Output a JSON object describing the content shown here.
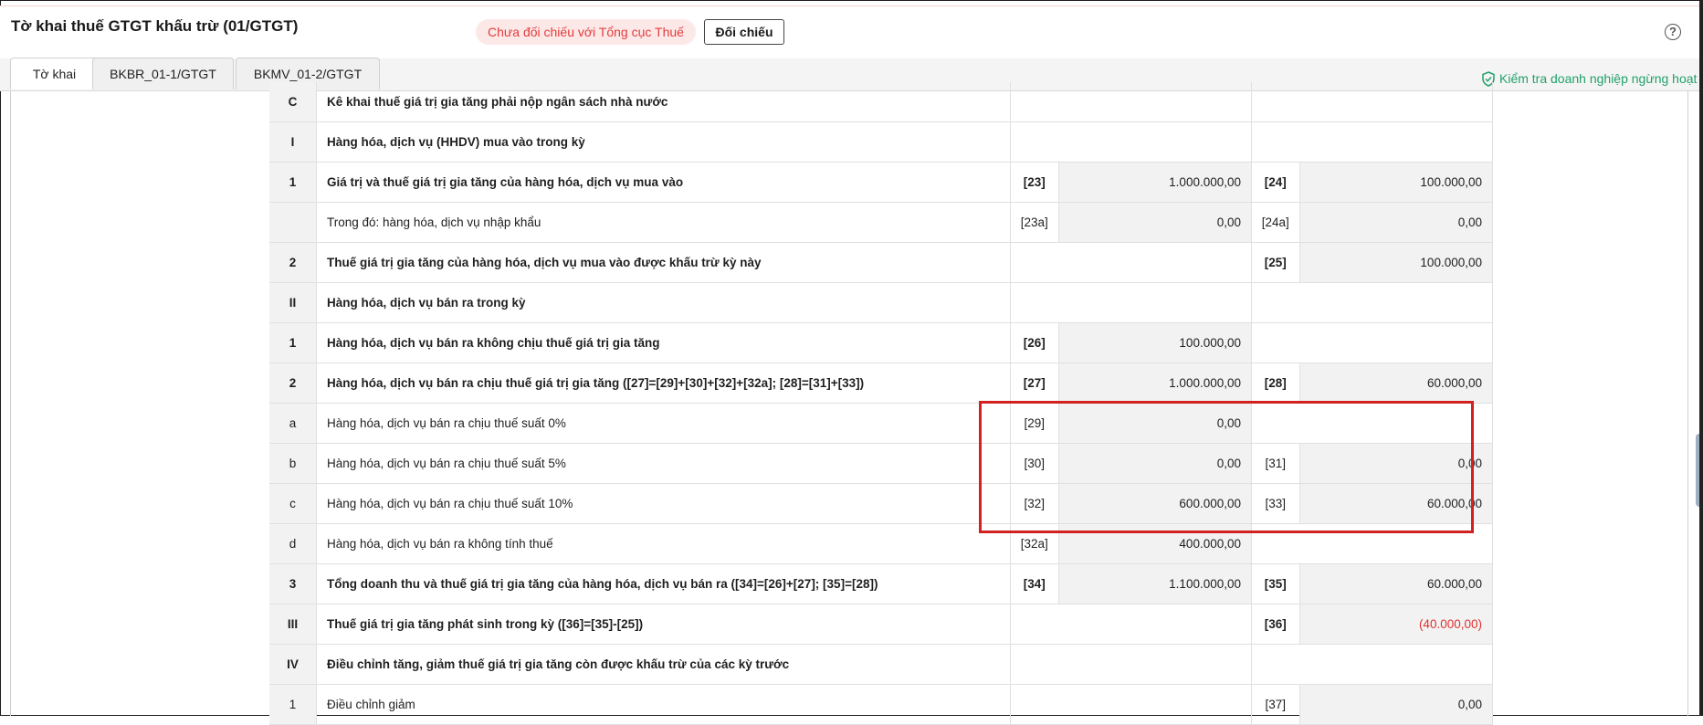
{
  "header": {
    "title": "Tờ khai thuế GTGT khấu trừ (01/GTGT)",
    "status_badge": "Chưa đối chiếu với Tổng cục Thuế",
    "compare_button": "Đối chiếu",
    "help_icon": "help-circle-icon"
  },
  "tabs": [
    {
      "label": "Tờ khai",
      "active": true
    },
    {
      "label": "BKBR_01-1/GTGT",
      "active": false
    },
    {
      "label": "BKMV_01-2/GTGT",
      "active": false
    }
  ],
  "check_link": {
    "icon": "shield-check-icon",
    "label": "Kiểm tra doanh nghiệp ngừng hoạt động"
  },
  "colors": {
    "accent_green": "#22a06b",
    "badge_red": "#e33b3b",
    "negative_red": "#e03030",
    "highlight_red": "#d32020"
  },
  "table": {
    "rows": [
      {
        "no": "C",
        "desc": "Kê khai thuế giá trị gia tăng phải nộp ngân sách nhà nước",
        "bold": true,
        "code1": "",
        "val1": "",
        "code2": "",
        "val2": ""
      },
      {
        "no": "I",
        "desc": "Hàng hóa, dịch vụ (HHDV) mua vào trong kỳ",
        "bold": true,
        "code1": "",
        "val1": "",
        "code2": "",
        "val2": ""
      },
      {
        "no": "1",
        "desc": "Giá trị và thuế giá trị gia tăng của hàng hóa, dịch vụ mua vào",
        "bold": true,
        "code1": "[23]",
        "val1": "1.000.000,00",
        "code2": "[24]",
        "val2": "100.000,00"
      },
      {
        "no": "",
        "desc": "Trong đó: hàng hóa, dịch vụ nhập khẩu",
        "bold": false,
        "code1": "[23a]",
        "val1": "0,00",
        "code2": "[24a]",
        "val2": "0,00"
      },
      {
        "no": "2",
        "desc": "Thuế giá trị gia tăng của hàng hóa, dịch vụ mua vào được khấu trừ kỳ này",
        "bold": true,
        "code1": "",
        "val1": "",
        "code2": "[25]",
        "val2": "100.000,00"
      },
      {
        "no": "II",
        "desc": "Hàng hóa, dịch vụ bán ra trong kỳ",
        "bold": true,
        "code1": "",
        "val1": "",
        "code2": "",
        "val2": ""
      },
      {
        "no": "1",
        "desc": "Hàng hóa, dịch vụ bán ra không chịu thuế giá trị gia tăng",
        "bold": true,
        "code1": "[26]",
        "val1": "100.000,00",
        "code2": "",
        "val2": ""
      },
      {
        "no": "2",
        "desc": "Hàng hóa, dịch vụ bán ra chịu thuế giá trị gia tăng ([27]=[29]+[30]+[32]+[32a]; [28]=[31]+[33])",
        "bold": true,
        "code1": "[27]",
        "val1": "1.000.000,00",
        "code2": "[28]",
        "val2": "60.000,00"
      },
      {
        "no": "a",
        "desc": "Hàng hóa, dịch vụ bán ra chịu thuế suất 0%",
        "bold": false,
        "code1": "[29]",
        "val1": "0,00",
        "code2": "",
        "val2": ""
      },
      {
        "no": "b",
        "desc": "Hàng hóa, dịch vụ bán ra chịu thuế suất 5%",
        "bold": false,
        "code1": "[30]",
        "val1": "0,00",
        "code2": "[31]",
        "val2": "0,00"
      },
      {
        "no": "c",
        "desc": "Hàng hóa, dịch vụ bán ra chịu thuế suất 10%",
        "bold": false,
        "code1": "[32]",
        "val1": "600.000,00",
        "code2": "[33]",
        "val2": "60.000,00"
      },
      {
        "no": "d",
        "desc": "Hàng hóa, dịch vụ bán ra không tính thuế",
        "bold": false,
        "code1": "[32a]",
        "val1": "400.000,00",
        "code2": "",
        "val2": ""
      },
      {
        "no": "3",
        "desc": "Tổng doanh thu và thuế giá trị gia tăng của hàng hóa, dịch vụ bán ra ([34]=[26]+[27]; [35]=[28])",
        "bold": true,
        "code1": "[34]",
        "val1": "1.100.000,00",
        "code2": "[35]",
        "val2": "60.000,00"
      },
      {
        "no": "III",
        "desc": "Thuế giá trị gia tăng phát sinh trong kỳ ([36]=[35]-[25])",
        "bold": true,
        "code1": "",
        "val1": "",
        "code2": "[36]",
        "val2": "(40.000,00)",
        "val2_negative": true
      },
      {
        "no": "IV",
        "desc": "Điều chỉnh tăng, giảm thuế giá trị gia tăng còn được khấu trừ của các kỳ trước",
        "bold": true,
        "code1": "",
        "val1": "",
        "code2": "",
        "val2": ""
      },
      {
        "no": "1",
        "desc": "Điều chỉnh giảm",
        "bold": false,
        "code1": "",
        "val1": "",
        "code2": "[37]",
        "val2": "0,00"
      }
    ]
  }
}
